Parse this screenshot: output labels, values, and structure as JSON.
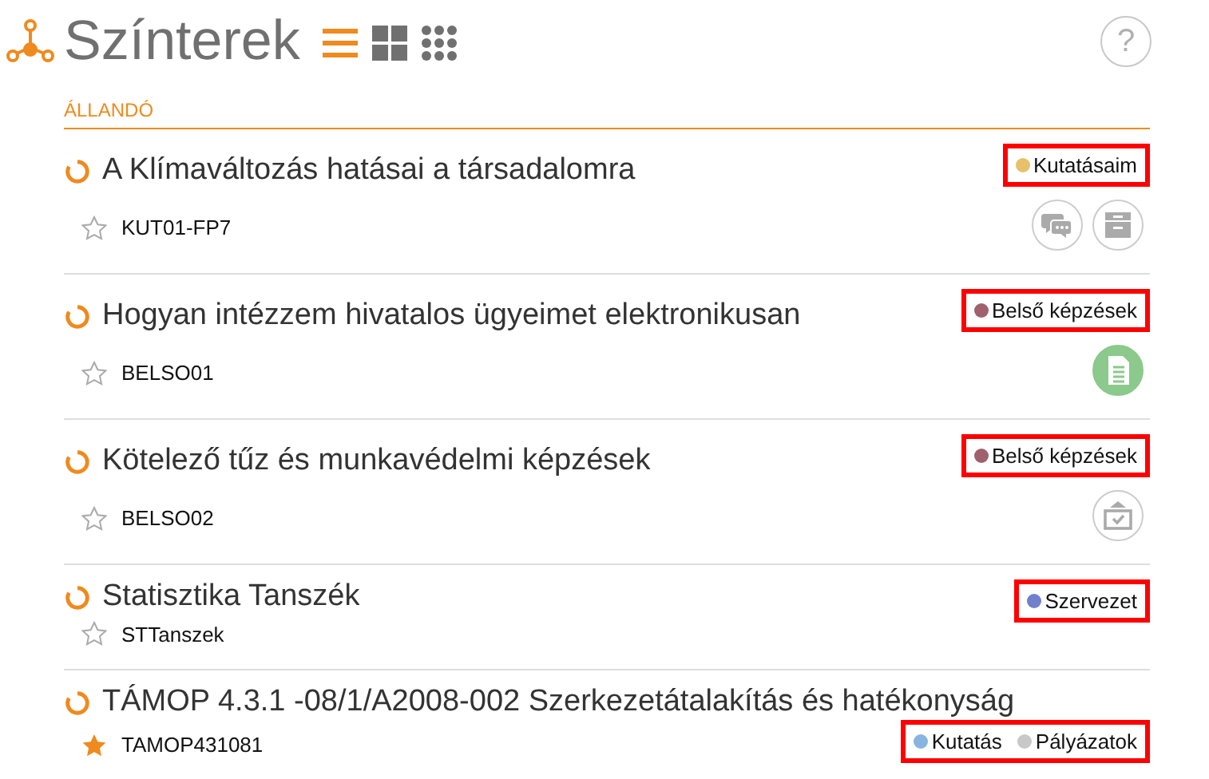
{
  "header": {
    "title": "Színterek",
    "help": "?"
  },
  "view_modes": [
    {
      "kind": "list",
      "selected": true
    },
    {
      "kind": "tiles",
      "selected": false
    },
    {
      "kind": "dots",
      "selected": false
    }
  ],
  "section": {
    "title": "ÁLLANDÓ"
  },
  "items": [
    {
      "title": "A Klímaváltozás hatásai a társadalomra",
      "code": "KUT01-FP7",
      "starred": false,
      "highlighted": true,
      "tags": [
        {
          "label": "Kutatásaim",
          "color": "#e8c06a"
        }
      ],
      "actions": [
        {
          "kind": "chat"
        },
        {
          "kind": "archive"
        }
      ]
    },
    {
      "title": "Hogyan intézzem hivatalos ügyeimet elektronikusan",
      "code": "BELSO01",
      "starred": false,
      "highlighted": true,
      "tags": [
        {
          "label": "Belső képzések",
          "color": "#a0606e"
        }
      ],
      "actions": [
        {
          "kind": "document"
        }
      ]
    },
    {
      "title": "Kötelező tűz és munkavédelmi képzések",
      "code": "BELSO02",
      "starred": false,
      "highlighted": true,
      "tags": [
        {
          "label": "Belső képzések",
          "color": "#a0606e"
        }
      ],
      "actions": [
        {
          "kind": "task"
        }
      ]
    },
    {
      "title": "Statisztika Tanszék",
      "code": "STTanszek",
      "starred": false,
      "highlighted": true,
      "tags": [
        {
          "label": "Szervezet",
          "color": "#7080cc"
        }
      ]
    },
    {
      "title": "TÁMOP 4.3.1 -08/1/A2008-002 Szerkezetátalakítás és hatékonyság",
      "code": "TAMOP431081",
      "starred": true,
      "highlighted": true,
      "tags": [
        {
          "label": "Kutatás",
          "color": "#88b4e0"
        },
        {
          "label": "Pályázatok",
          "color": "#c8c8c8"
        }
      ]
    }
  ]
}
